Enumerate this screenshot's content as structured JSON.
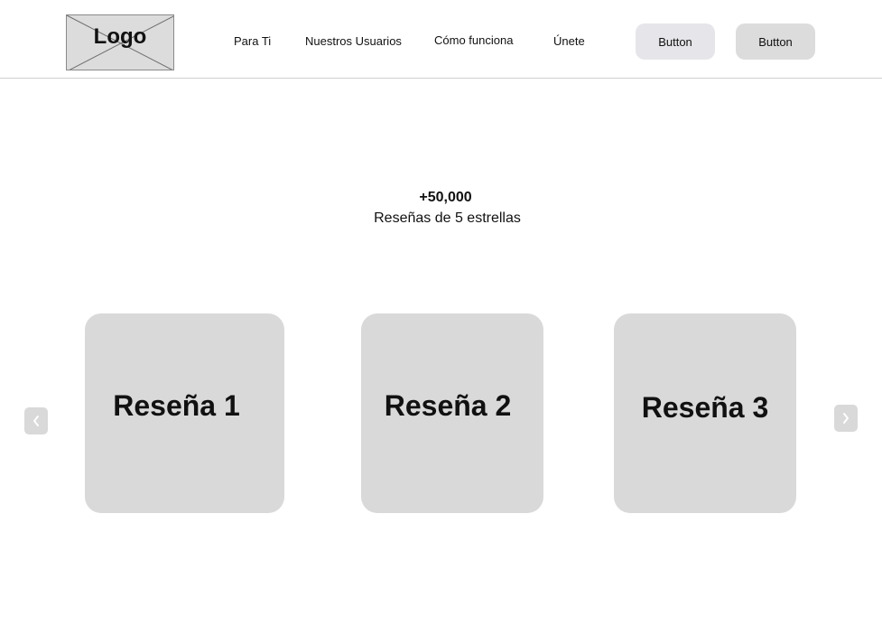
{
  "header": {
    "logo_text": "Logo",
    "nav": [
      {
        "label": "Para Ti"
      },
      {
        "label": "Nuestros Usuarios"
      },
      {
        "label": "Cómo funciona"
      },
      {
        "label": "Únete"
      }
    ],
    "buttons": [
      {
        "label": "Button"
      },
      {
        "label": "Button"
      }
    ]
  },
  "stats": {
    "count": "+50,000",
    "label": "Reseñas de 5 estrellas"
  },
  "reviews": [
    {
      "title": "Reseña 1"
    },
    {
      "title": "Reseña 2"
    },
    {
      "title": "Reseña 3"
    }
  ],
  "carousel": {
    "prev_icon": "chevron-left-icon",
    "next_icon": "chevron-right-icon"
  },
  "colors": {
    "card_bg": "#d9d9d9",
    "button_primary_bg": "#e6e6ea",
    "button_secondary_bg": "#dcdcdc",
    "arrow_icon": "#ffffff"
  }
}
